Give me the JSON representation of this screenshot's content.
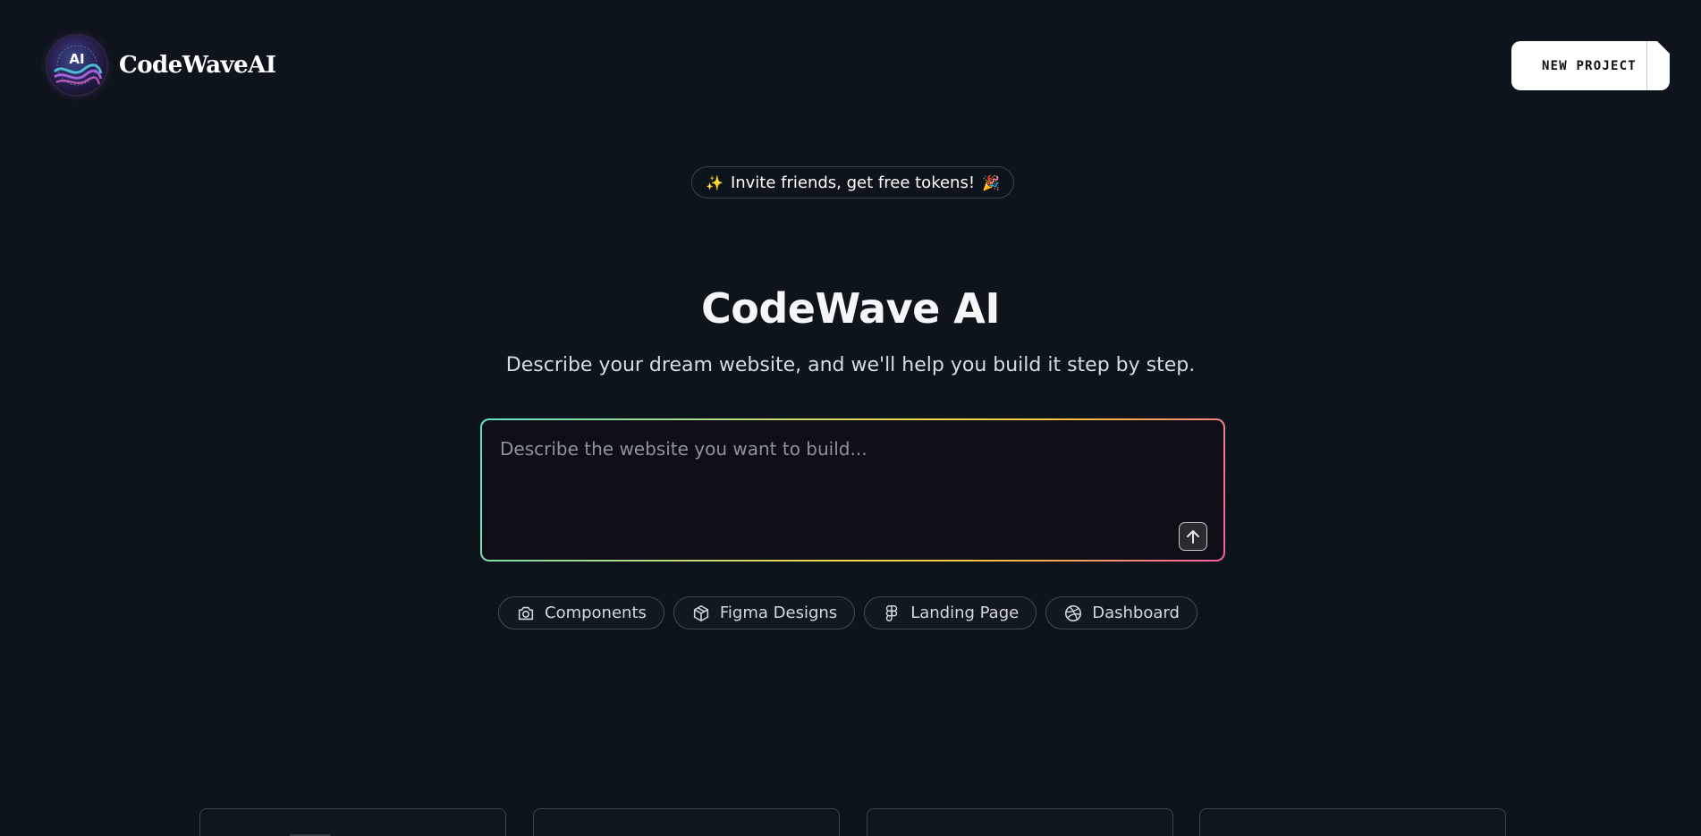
{
  "header": {
    "brand_name": "CodeWaveAI",
    "logo_text": "AI",
    "new_project_label": "NEW PROJECT"
  },
  "invite": {
    "text": "Invite friends, get free tokens!",
    "leading_icon": "sparkles-icon",
    "trailing_icon": "party-popper-icon"
  },
  "hero": {
    "title": "CodeWave AI",
    "subtitle": "Describe your dream website, and we'll help you build it step by step."
  },
  "prompt": {
    "placeholder": "Describe the website you want to build...",
    "value": "",
    "submit_icon": "arrow-up-icon"
  },
  "chips": [
    {
      "label": "Components",
      "icon": "camera-icon"
    },
    {
      "label": "Figma Designs",
      "icon": "package-icon"
    },
    {
      "label": "Landing Page",
      "icon": "figma-icon"
    },
    {
      "label": "Dashboard",
      "icon": "dribbble-icon"
    }
  ],
  "cards": [
    {},
    {},
    {},
    {}
  ],
  "colors": {
    "background": "#0e141b",
    "prompt_gradient": [
      "#5fe3c8",
      "#f3d54a",
      "#f25da2"
    ],
    "button_bg": "#ffffff"
  }
}
